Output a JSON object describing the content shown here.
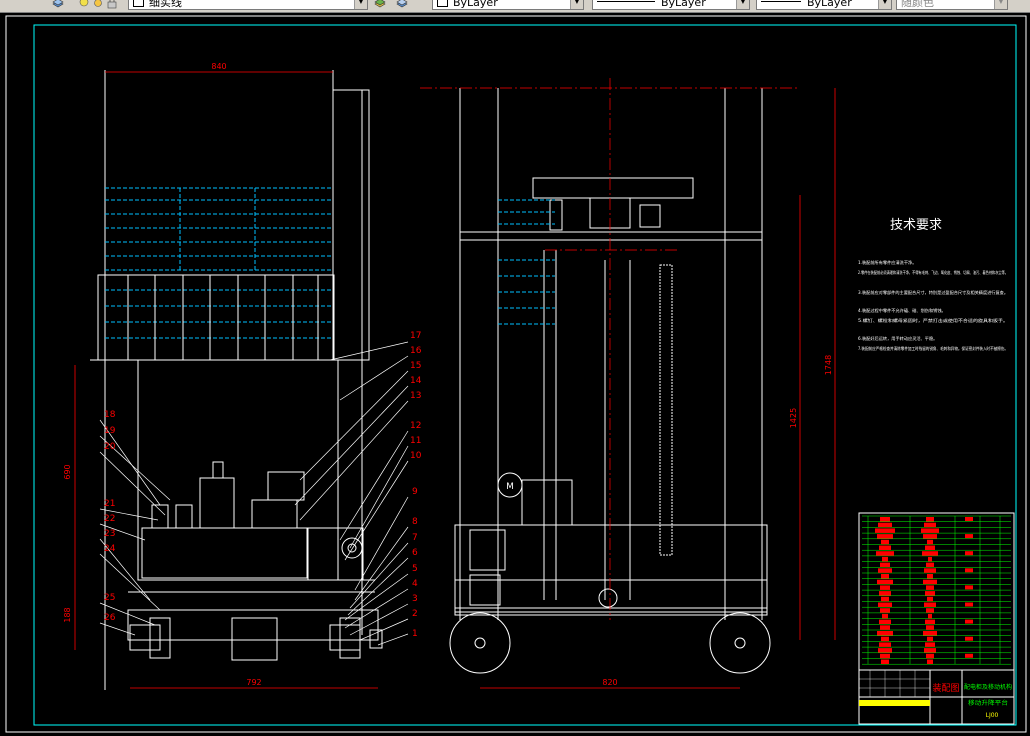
{
  "toolbar": {
    "layer_name": "细实线",
    "color_value": "ByLayer",
    "linetype_value": "ByLayer",
    "lineweight_value": "ByLayer",
    "plotstyle_value": "随颜色"
  },
  "dimensions": {
    "top_width": "840",
    "left_height_upper": "690",
    "left_height_lower": "188",
    "bottom_width_left": "792",
    "bottom_width_right": "820",
    "right_height_inner": "1425",
    "right_height_outer": "1748"
  },
  "balloons": [
    "17",
    "16",
    "15",
    "14",
    "13",
    "12",
    "11",
    "10",
    "9",
    "8",
    "7",
    "6",
    "5",
    "4",
    "3",
    "2",
    "1",
    "18",
    "19",
    "20",
    "21",
    "22",
    "23",
    "24",
    "25",
    "26"
  ],
  "motor_label": "M",
  "technical_requirements": {
    "title": "技术要求",
    "items": [
      "1.装配前所有零件应清洗干净。",
      "2.零件在装配前必须清理和清洗干净，不得有毛刺、飞边、氧化皮、锈蚀、切屑、油污、着色剂和灰尘等。",
      "3.装配前应对零部件的主要配合尺寸，特别是过盈配合尺寸及相关精度进行复查。",
      "4.装配过程中零件不允许磕、碰、划伤和锈蚀。",
      "5.螺钉、螺栓和螺母紧固时，严禁打击或使用不合适的旋具和扳手。",
      "6.装配好后运转，用手转动应灵活、平稳。",
      "7.装配前应严格检查并清除零件加工时残留的锐角、毛刺和异物。保证密封件装入时不被擦伤。"
    ]
  },
  "title_block": {
    "drawing_type": "装配图",
    "project_name": "配电柜及移动机构",
    "part_name": "移动升降平台",
    "drawing_no": "LJ00"
  },
  "colors": {
    "background": "#000000",
    "frame_line": "#00ffff",
    "geometry": "#ffffff",
    "dimension": "#ff0000",
    "hatch": "#00bfff",
    "title_green": "#00ff00"
  }
}
